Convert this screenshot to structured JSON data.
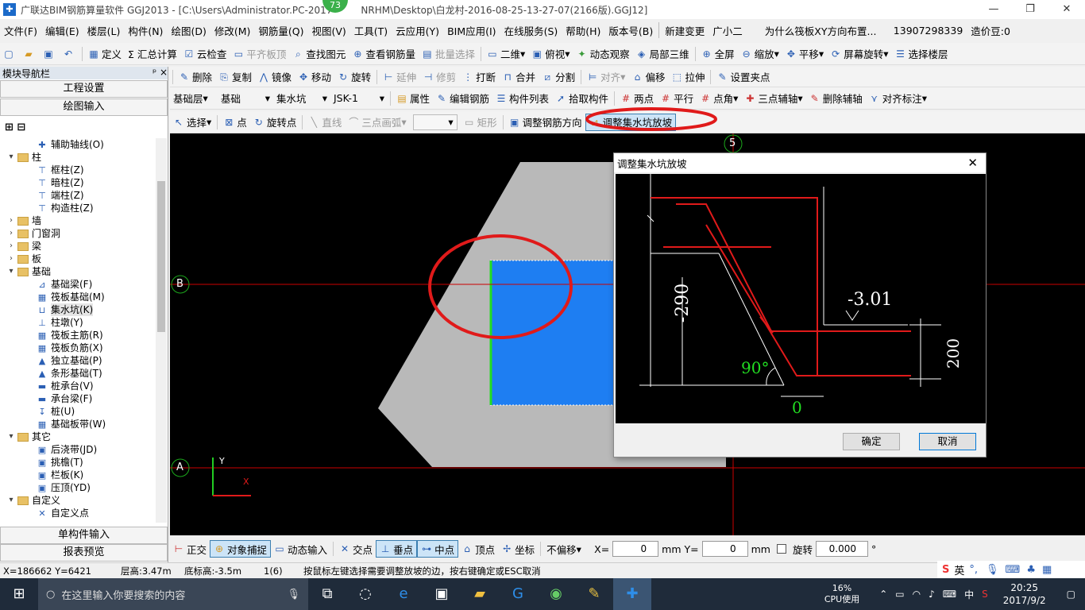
{
  "window": {
    "title": "广联达BIM钢筋算量软件 GGJ2013 - [C:\\Users\\Administrator.PC-2017",
    "title_tail": "NRHM\\Desktop\\白龙村-2016-08-25-13-27-07(2166版).GGJ12]",
    "badge": "73",
    "min": "—",
    "restore": "❐",
    "close": "✕"
  },
  "menu": {
    "items": [
      "文件(F)",
      "编辑(E)",
      "楼层(L)",
      "构件(N)",
      "绘图(D)",
      "修改(M)",
      "钢筋量(Q)",
      "视图(V)",
      "工具(T)",
      "云应用(Y)",
      "BIM应用(I)",
      "在线服务(S)",
      "帮助(H)",
      "版本号(B)",
      "新建变更",
      "广小二"
    ],
    "question": "为什么筏板XY方向布置...",
    "phone": "13907298339",
    "price": "造价豆:0"
  },
  "toolbar1": [
    "定义",
    "Σ 汇总计算",
    "云检查",
    "平齐板顶",
    "查找图元",
    "查看钢筋量",
    "批量选择",
    "二维",
    "俯视",
    "动态观察",
    "局部三维",
    "全屏",
    "缩放",
    "平移",
    "屏幕旋转",
    "选择楼层"
  ],
  "toolbar2": [
    "删除",
    "复制",
    "镜像",
    "移动",
    "旋转",
    "延伸",
    "修剪",
    "打断",
    "合并",
    "分割",
    "对齐",
    "偏移",
    "拉伸",
    "设置夹点"
  ],
  "toolbar3": {
    "layer": "基础层",
    "type": "基础",
    "member": "集水坑",
    "name": "JSK-1",
    "buttons": [
      "属性",
      "编辑钢筋",
      "构件列表",
      "拾取构件",
      "两点",
      "平行",
      "点角",
      "三点辅轴",
      "删除辅轴",
      "对齐标注"
    ]
  },
  "toolbar4": [
    "选择",
    "点",
    "旋转点",
    "直线",
    "三点画弧",
    "矩形",
    "调整钢筋方向",
    "调整集水坑放坡"
  ],
  "panel": {
    "title": "模块导航栏",
    "pin": "ᵖ ×",
    "tab1": "工程设置",
    "tab2": "绘图输入",
    "tab3": "单构件输入",
    "tab4": "报表预览",
    "tree": [
      {
        "t": "",
        "lvl": 2,
        "label": "辅助轴线(O)",
        "icon": "axis"
      },
      {
        "t": "▾",
        "lvl": 1,
        "label": "柱",
        "icon": "folder"
      },
      {
        "t": "",
        "lvl": 2,
        "label": "框柱(Z)",
        "icon": "col"
      },
      {
        "t": "",
        "lvl": 2,
        "label": "暗柱(Z)",
        "icon": "col"
      },
      {
        "t": "",
        "lvl": 2,
        "label": "端柱(Z)",
        "icon": "col"
      },
      {
        "t": "",
        "lvl": 2,
        "label": "构造柱(Z)",
        "icon": "col"
      },
      {
        "t": "›",
        "lvl": 1,
        "label": "墙",
        "icon": "folder"
      },
      {
        "t": "›",
        "lvl": 1,
        "label": "门窗洞",
        "icon": "folder"
      },
      {
        "t": "›",
        "lvl": 1,
        "label": "梁",
        "icon": "folder"
      },
      {
        "t": "›",
        "lvl": 1,
        "label": "板",
        "icon": "folder"
      },
      {
        "t": "▾",
        "lvl": 1,
        "label": "基础",
        "icon": "folder"
      },
      {
        "t": "",
        "lvl": 2,
        "label": "基础梁(F)",
        "icon": "beam"
      },
      {
        "t": "",
        "lvl": 2,
        "label": "筏板基础(M)",
        "icon": "grid"
      },
      {
        "t": "",
        "lvl": 2,
        "label": "集水坑(K)",
        "icon": "pit",
        "sel": true
      },
      {
        "t": "",
        "lvl": 2,
        "label": "柱墩(Y)",
        "icon": "pier"
      },
      {
        "t": "",
        "lvl": 2,
        "label": "筏板主筋(R)",
        "icon": "grid"
      },
      {
        "t": "",
        "lvl": 2,
        "label": "筏板负筋(X)",
        "icon": "grid"
      },
      {
        "t": "",
        "lvl": 2,
        "label": "独立基础(P)",
        "icon": "found"
      },
      {
        "t": "",
        "lvl": 2,
        "label": "条形基础(T)",
        "icon": "found"
      },
      {
        "t": "",
        "lvl": 2,
        "label": "桩承台(V)",
        "icon": "cap"
      },
      {
        "t": "",
        "lvl": 2,
        "label": "承台梁(F)",
        "icon": "cap"
      },
      {
        "t": "",
        "lvl": 2,
        "label": "桩(U)",
        "icon": "pile"
      },
      {
        "t": "",
        "lvl": 2,
        "label": "基础板带(W)",
        "icon": "grid"
      },
      {
        "t": "▾",
        "lvl": 1,
        "label": "其它",
        "icon": "folder"
      },
      {
        "t": "",
        "lvl": 2,
        "label": "后浇带(JD)",
        "icon": "post"
      },
      {
        "t": "",
        "lvl": 2,
        "label": "挑檐(T)",
        "icon": "post"
      },
      {
        "t": "",
        "lvl": 2,
        "label": "栏板(K)",
        "icon": "post"
      },
      {
        "t": "",
        "lvl": 2,
        "label": "压顶(YD)",
        "icon": "post"
      },
      {
        "t": "▾",
        "lvl": 1,
        "label": "自定义",
        "icon": "folder"
      },
      {
        "t": "",
        "lvl": 2,
        "label": "自定义点",
        "icon": "cross"
      }
    ]
  },
  "canvas": {
    "axis_5": "5",
    "axis_B": "B",
    "axis_A": "A",
    "y": "Y",
    "x": "X"
  },
  "dialog": {
    "title": "调整集水坑放坡",
    "close": "✕",
    "dim_left": "-290",
    "dim_top": "-3.01",
    "dim_right": "200",
    "angle": "90°",
    "bottom": "0",
    "ok": "确定",
    "cancel": "取消"
  },
  "status": {
    "buttons": [
      "正交",
      "对象捕捉",
      "动态输入",
      "交点",
      "垂点",
      "中点",
      "顶点",
      "坐标"
    ],
    "offset": "不偏移",
    "x_label": "X=",
    "x_value": "0",
    "y_label": "mm Y=",
    "y_value": "0",
    "unit": "mm",
    "rotate": "旋转",
    "rotate_value": "0.000",
    "deg": "°"
  },
  "info": {
    "coords": "X=186662  Y=6421",
    "floor_height": "层高:3.47m",
    "bottom_height": "底标高:-3.5m",
    "count": "1(6)",
    "hint": "按鼠标左键选择需要调整放坡的边，按右键确定或ESC取消"
  },
  "ime": {
    "lang": "英"
  },
  "taskbar": {
    "search": "在这里输入你要搜索的内容",
    "cpu_pct": "16%",
    "cpu_label": "CPU使用",
    "ime": "中",
    "time": "20:25",
    "date": "2017/9/2"
  }
}
